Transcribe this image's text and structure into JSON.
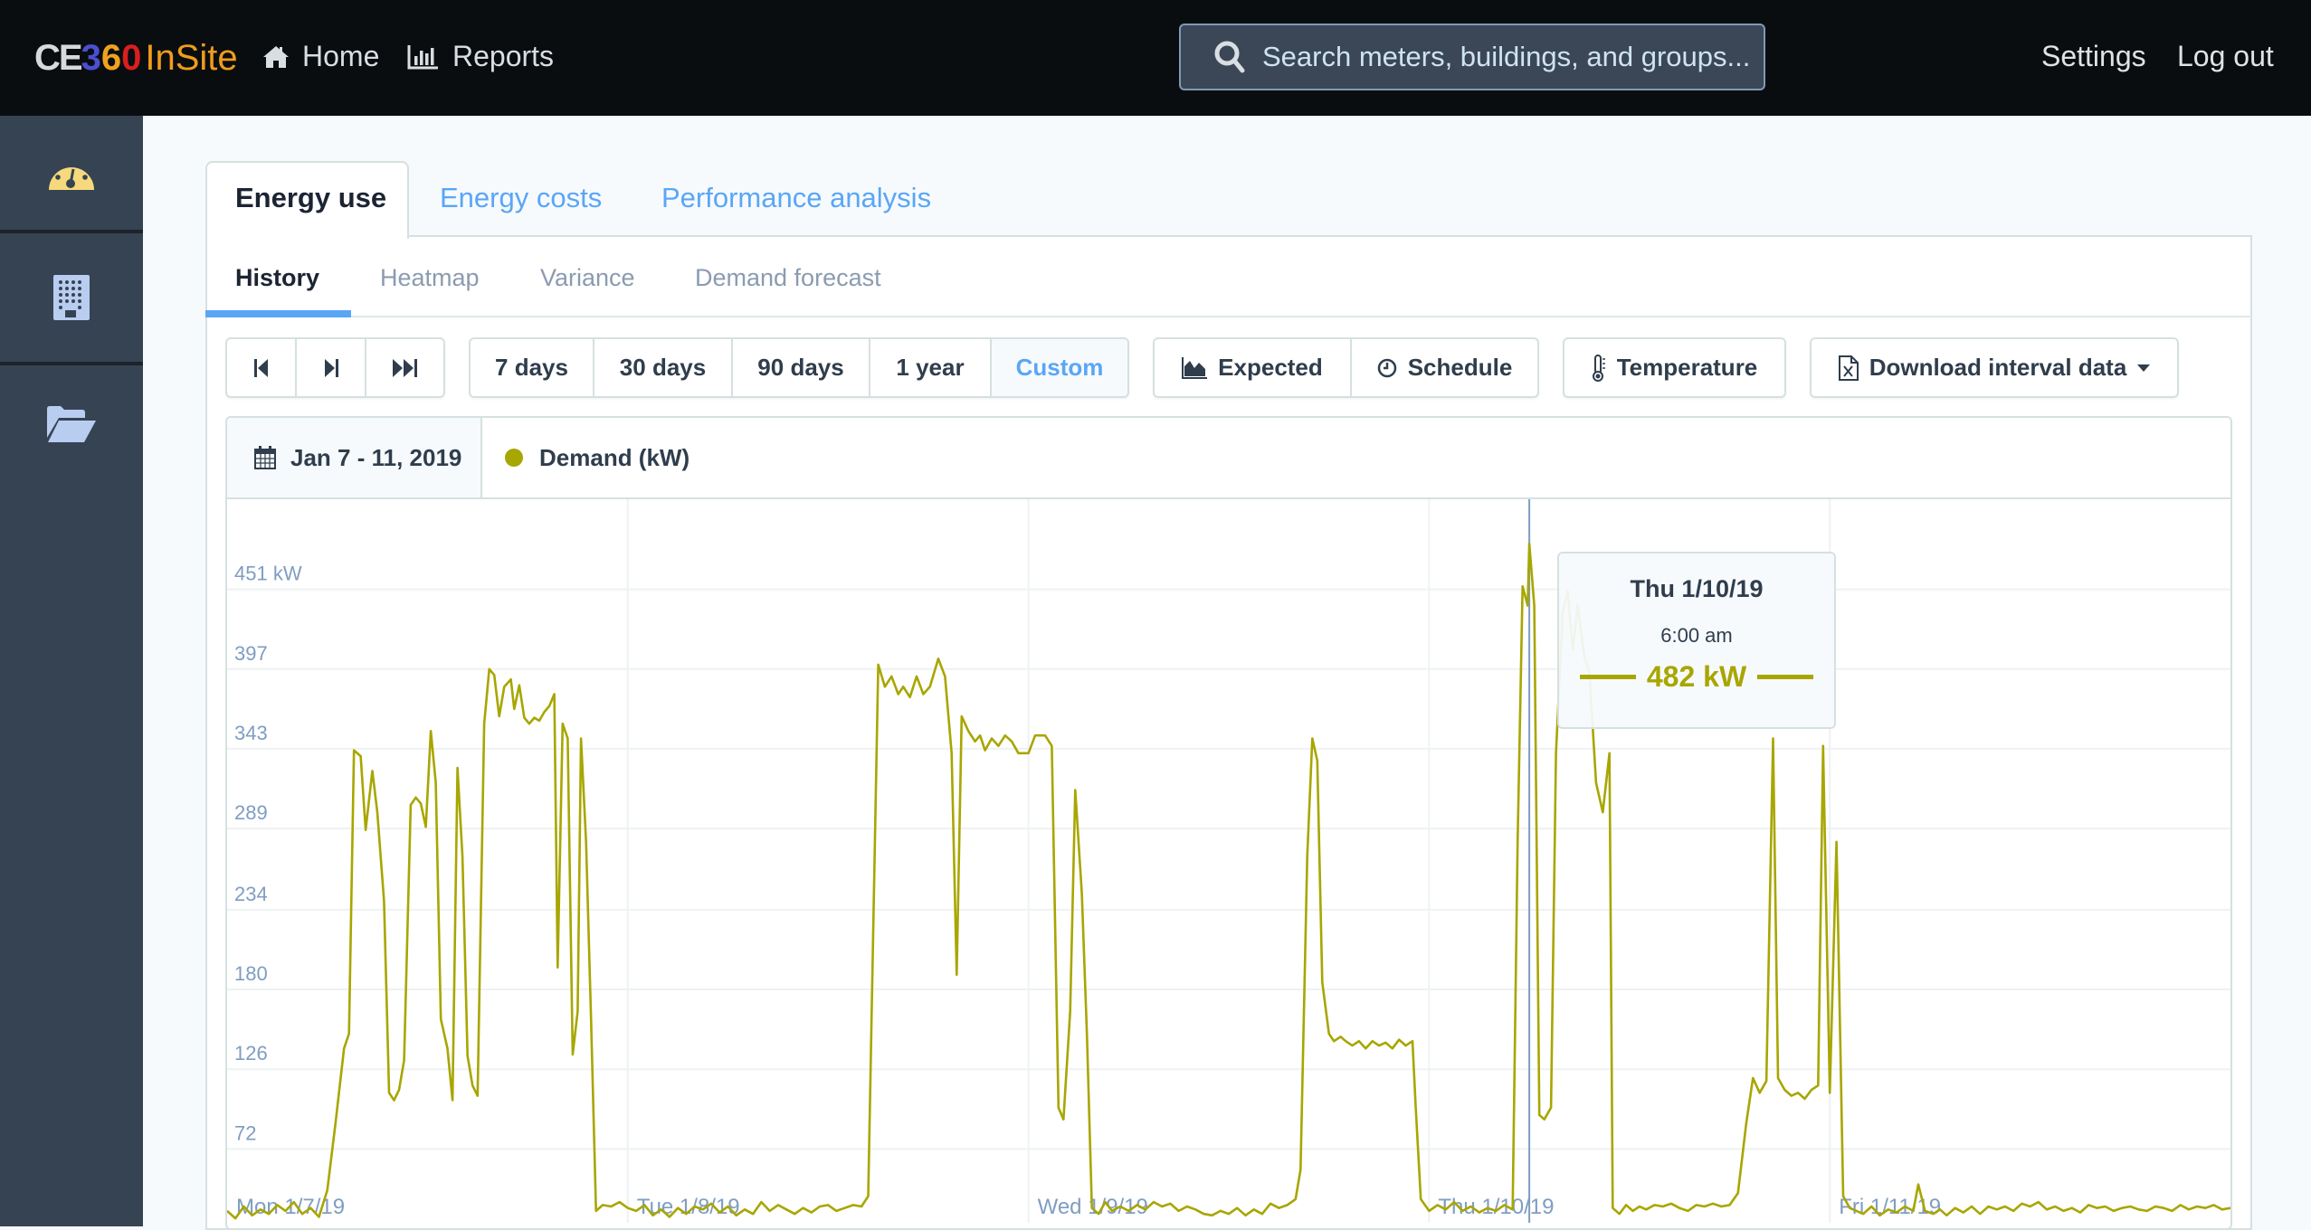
{
  "app": {
    "logo": {
      "ce": "CE",
      "n3": "3",
      "n6": "6",
      "n0": "0",
      "insite": "InSite"
    },
    "nav": [
      {
        "label": "Home",
        "icon": "home-icon"
      },
      {
        "label": "Reports",
        "icon": "bar-chart-icon"
      }
    ],
    "search": {
      "placeholder": "Search meters, buildings, and groups...",
      "value": ""
    },
    "right_links": [
      "Settings",
      "Log out"
    ]
  },
  "sidebar": {
    "items": [
      {
        "name": "dashboard",
        "icon": "speedometer-icon"
      },
      {
        "name": "buildings",
        "icon": "building-icon"
      },
      {
        "name": "groups",
        "icon": "folder-open-icon"
      }
    ]
  },
  "tabs": {
    "main": [
      {
        "label": "Energy use",
        "active": true
      },
      {
        "label": "Energy costs",
        "active": false
      },
      {
        "label": "Performance analysis",
        "active": false
      }
    ],
    "sub": [
      {
        "label": "History",
        "active": true
      },
      {
        "label": "Heatmap",
        "active": false
      },
      {
        "label": "Variance",
        "active": false
      },
      {
        "label": "Demand forecast",
        "active": false
      }
    ]
  },
  "toolbar": {
    "nav_buttons": [
      "skip-back-icon",
      "step-forward-icon",
      "skip-forward-icon"
    ],
    "ranges": [
      {
        "label": "7 days",
        "active": false
      },
      {
        "label": "30 days",
        "active": false
      },
      {
        "label": "90 days",
        "active": false
      },
      {
        "label": "1 year",
        "active": false
      },
      {
        "label": "Custom",
        "active": true
      }
    ],
    "overlays": [
      {
        "label": "Expected",
        "icon": "area-chart-icon"
      },
      {
        "label": "Schedule",
        "icon": "clock-icon"
      }
    ],
    "temperature": {
      "label": "Temperature",
      "icon": "thermometer-icon"
    },
    "download": {
      "label": "Download interval data",
      "icon": "excel-file-icon"
    }
  },
  "chart_header": {
    "date_range": "Jan 7 - 11, 2019",
    "legend": "Demand (kW)"
  },
  "colors": {
    "series": "#a8a600",
    "accent": "#5aa6f6",
    "topbar": "#0a0d10",
    "sidebar": "#364353"
  },
  "tooltip": {
    "date": "Thu 1/10/19",
    "time": "6:00 am",
    "value": "482 kW"
  },
  "chart_data": {
    "type": "line",
    "title": "",
    "xlabel": "",
    "ylabel": "Demand (kW)",
    "series_name": "Demand (kW)",
    "y_ticks": [
      "451 kW",
      "397",
      "343",
      "289",
      "234",
      "180",
      "126",
      "72"
    ],
    "y_tick_values": [
      451,
      397,
      343,
      289,
      234,
      180,
      126,
      72
    ],
    "ylim": [
      22,
      512
    ],
    "x_ticks": [
      "Mon 1/7/19",
      "Tue 1/8/19",
      "Wed 1/9/19",
      "Thu 1/10/19",
      "Fri 1/11/19"
    ],
    "xlim_hours": [
      0,
      120
    ],
    "grid": true,
    "crosshair_hour": 78,
    "points": [
      [
        0,
        30
      ],
      [
        0.5,
        25
      ],
      [
        1,
        33
      ],
      [
        1.5,
        27
      ],
      [
        2,
        31
      ],
      [
        2.5,
        28
      ],
      [
        3,
        34
      ],
      [
        3.5,
        30
      ],
      [
        4,
        36
      ],
      [
        4.5,
        28
      ],
      [
        5,
        32
      ],
      [
        5.5,
        26
      ],
      [
        6,
        44
      ],
      [
        6.5,
        90
      ],
      [
        7,
        140
      ],
      [
        7.3,
        150
      ],
      [
        7.6,
        342
      ],
      [
        8,
        338
      ],
      [
        8.3,
        288
      ],
      [
        8.7,
        328
      ],
      [
        9,
        300
      ],
      [
        9.4,
        240
      ],
      [
        9.7,
        110
      ],
      [
        10,
        105
      ],
      [
        10.3,
        112
      ],
      [
        10.6,
        132
      ],
      [
        11,
        305
      ],
      [
        11.3,
        310
      ],
      [
        11.6,
        306
      ],
      [
        11.9,
        290
      ],
      [
        12.2,
        355
      ],
      [
        12.5,
        320
      ],
      [
        12.8,
        160
      ],
      [
        13.2,
        140
      ],
      [
        13.5,
        105
      ],
      [
        13.8,
        330
      ],
      [
        14.1,
        270
      ],
      [
        14.4,
        135
      ],
      [
        14.7,
        115
      ],
      [
        15,
        108
      ],
      [
        15.4,
        360
      ],
      [
        15.7,
        397
      ],
      [
        16,
        393
      ],
      [
        16.3,
        365
      ],
      [
        16.6,
        385
      ],
      [
        17,
        390
      ],
      [
        17.2,
        370
      ],
      [
        17.5,
        386
      ],
      [
        17.8,
        364
      ],
      [
        18.1,
        360
      ],
      [
        18.4,
        364
      ],
      [
        18.7,
        362
      ],
      [
        19,
        368
      ],
      [
        19.3,
        372
      ],
      [
        19.6,
        380
      ],
      [
        19.8,
        195
      ],
      [
        20.1,
        360
      ],
      [
        20.4,
        350
      ],
      [
        20.7,
        136
      ],
      [
        21,
        165
      ],
      [
        21.2,
        350
      ],
      [
        21.5,
        280
      ],
      [
        21.8,
        160
      ],
      [
        22.1,
        30
      ],
      [
        22.5,
        34
      ],
      [
        23,
        33
      ],
      [
        23.5,
        36
      ],
      [
        24,
        32
      ],
      [
        24.5,
        30
      ],
      [
        25,
        34
      ],
      [
        25.5,
        27
      ],
      [
        26,
        31
      ],
      [
        26.5,
        26
      ],
      [
        27,
        32
      ],
      [
        27.5,
        28
      ],
      [
        28,
        33
      ],
      [
        28.5,
        31
      ],
      [
        29,
        35
      ],
      [
        29.5,
        29
      ],
      [
        30,
        33
      ],
      [
        30.5,
        27
      ],
      [
        31,
        31
      ],
      [
        31.5,
        28
      ],
      [
        32,
        36
      ],
      [
        32.5,
        30
      ],
      [
        33,
        34
      ],
      [
        33.5,
        31
      ],
      [
        34,
        28
      ],
      [
        34.5,
        32
      ],
      [
        35,
        29
      ],
      [
        35.5,
        33
      ],
      [
        36,
        34
      ],
      [
        36.5,
        30
      ],
      [
        37,
        32
      ],
      [
        37.5,
        34
      ],
      [
        38,
        33
      ],
      [
        38.4,
        40
      ],
      [
        39,
        400
      ],
      [
        39.4,
        385
      ],
      [
        39.8,
        392
      ],
      [
        40.2,
        380
      ],
      [
        40.5,
        385
      ],
      [
        40.9,
        378
      ],
      [
        41.3,
        392
      ],
      [
        41.7,
        380
      ],
      [
        42.1,
        385
      ],
      [
        42.6,
        404
      ],
      [
        43,
        392
      ],
      [
        43.4,
        340
      ],
      [
        43.7,
        190
      ],
      [
        44,
        365
      ],
      [
        44.4,
        355
      ],
      [
        44.8,
        348
      ],
      [
        45.1,
        352
      ],
      [
        45.4,
        342
      ],
      [
        45.8,
        350
      ],
      [
        46.2,
        345
      ],
      [
        46.6,
        352
      ],
      [
        47,
        348
      ],
      [
        47.4,
        340
      ],
      [
        48,
        340
      ],
      [
        48.4,
        352
      ],
      [
        49,
        352
      ],
      [
        49.4,
        345
      ],
      [
        49.8,
        100
      ],
      [
        50.1,
        92
      ],
      [
        50.5,
        165
      ],
      [
        50.8,
        315
      ],
      [
        51.2,
        245
      ],
      [
        51.5,
        150
      ],
      [
        51.8,
        32
      ],
      [
        52.2,
        28
      ],
      [
        52.6,
        36
      ],
      [
        53,
        30
      ],
      [
        53.5,
        33
      ],
      [
        54,
        30
      ],
      [
        54.5,
        34
      ],
      [
        55,
        31
      ],
      [
        55.5,
        36
      ],
      [
        56,
        33
      ],
      [
        56.5,
        35
      ],
      [
        57,
        30
      ],
      [
        57.5,
        33
      ],
      [
        58,
        31
      ],
      [
        58.5,
        28
      ],
      [
        59,
        27
      ],
      [
        59.5,
        30
      ],
      [
        60,
        28
      ],
      [
        60.5,
        32
      ],
      [
        61,
        27
      ],
      [
        61.5,
        31
      ],
      [
        62,
        28
      ],
      [
        62.5,
        35
      ],
      [
        63,
        32
      ],
      [
        63.5,
        34
      ],
      [
        64,
        38
      ],
      [
        64.3,
        58
      ],
      [
        64.7,
        270
      ],
      [
        65,
        350
      ],
      [
        65.3,
        335
      ],
      [
        65.6,
        185
      ],
      [
        66,
        150
      ],
      [
        66.3,
        145
      ],
      [
        66.7,
        148
      ],
      [
        67,
        145
      ],
      [
        67.4,
        142
      ],
      [
        67.8,
        145
      ],
      [
        68.2,
        140
      ],
      [
        68.6,
        145
      ],
      [
        69,
        142
      ],
      [
        69.4,
        144
      ],
      [
        69.8,
        140
      ],
      [
        70.2,
        146
      ],
      [
        70.6,
        142
      ],
      [
        71,
        145
      ],
      [
        71.2,
        100
      ],
      [
        71.5,
        38
      ],
      [
        72,
        30
      ],
      [
        72.5,
        34
      ],
      [
        73,
        31
      ],
      [
        73.5,
        36
      ],
      [
        74,
        30
      ],
      [
        74.5,
        33
      ],
      [
        75,
        29
      ],
      [
        75.5,
        32
      ],
      [
        76,
        30
      ],
      [
        76.5,
        34
      ],
      [
        77,
        31
      ],
      [
        77.3,
        280
      ],
      [
        77.6,
        453
      ],
      [
        77.9,
        440
      ],
      [
        78,
        482
      ],
      [
        78.3,
        440
      ],
      [
        78.6,
        95
      ],
      [
        78.9,
        92
      ],
      [
        79.3,
        100
      ],
      [
        79.6,
        340
      ],
      [
        80,
        435
      ],
      [
        80.3,
        450
      ],
      [
        80.6,
        410
      ],
      [
        80.9,
        440
      ],
      [
        81.3,
        405
      ],
      [
        81.6,
        395
      ],
      [
        82,
        320
      ],
      [
        82.4,
        300
      ],
      [
        82.8,
        340
      ],
      [
        83,
        32
      ],
      [
        83.4,
        28
      ],
      [
        83.8,
        34
      ],
      [
        84.2,
        30
      ],
      [
        84.6,
        33
      ],
      [
        85,
        31
      ],
      [
        85.5,
        34
      ],
      [
        86,
        33
      ],
      [
        86.5,
        35
      ],
      [
        87,
        32
      ],
      [
        87.5,
        30
      ],
      [
        88,
        34
      ],
      [
        88.5,
        33
      ],
      [
        89,
        35
      ],
      [
        89.5,
        33
      ],
      [
        90,
        34
      ],
      [
        90.5,
        42
      ],
      [
        91,
        90
      ],
      [
        91.4,
        120
      ],
      [
        91.8,
        110
      ],
      [
        92.2,
        118
      ],
      [
        92.6,
        350
      ],
      [
        92.9,
        120
      ],
      [
        93.3,
        112
      ],
      [
        93.7,
        108
      ],
      [
        94.1,
        110
      ],
      [
        94.5,
        106
      ],
      [
        94.9,
        112
      ],
      [
        95.3,
        115
      ],
      [
        95.6,
        345
      ],
      [
        96,
        110
      ],
      [
        96.4,
        280
      ],
      [
        96.8,
        40
      ],
      [
        97.2,
        32
      ],
      [
        97.6,
        30
      ],
      [
        98,
        28
      ],
      [
        98.5,
        33
      ],
      [
        99,
        27
      ],
      [
        99.5,
        31
      ],
      [
        100,
        29
      ],
      [
        100.5,
        33
      ],
      [
        101,
        30
      ],
      [
        101.3,
        48
      ],
      [
        101.7,
        30
      ],
      [
        102.2,
        28
      ],
      [
        102.6,
        31
      ],
      [
        103,
        27
      ],
      [
        103.5,
        32
      ],
      [
        104,
        29
      ],
      [
        104.5,
        33
      ],
      [
        105,
        28
      ],
      [
        105.5,
        33
      ],
      [
        106,
        31
      ],
      [
        106.5,
        33
      ],
      [
        107,
        30
      ],
      [
        107.5,
        35
      ],
      [
        108,
        33
      ],
      [
        108.5,
        36
      ],
      [
        109,
        31
      ],
      [
        109.5,
        33
      ],
      [
        110,
        30
      ],
      [
        110.5,
        32
      ],
      [
        111,
        29
      ],
      [
        111.5,
        34
      ],
      [
        112,
        32
      ],
      [
        112.5,
        33
      ],
      [
        113,
        30
      ],
      [
        113.5,
        32
      ],
      [
        114,
        33
      ],
      [
        114.5,
        31
      ],
      [
        115,
        30
      ],
      [
        115.5,
        33
      ],
      [
        116,
        32
      ],
      [
        116.5,
        30
      ],
      [
        117,
        34
      ],
      [
        117.5,
        31
      ],
      [
        118,
        33
      ],
      [
        118.5,
        32
      ],
      [
        119,
        34
      ],
      [
        119.5,
        31
      ],
      [
        120,
        32
      ]
    ]
  }
}
